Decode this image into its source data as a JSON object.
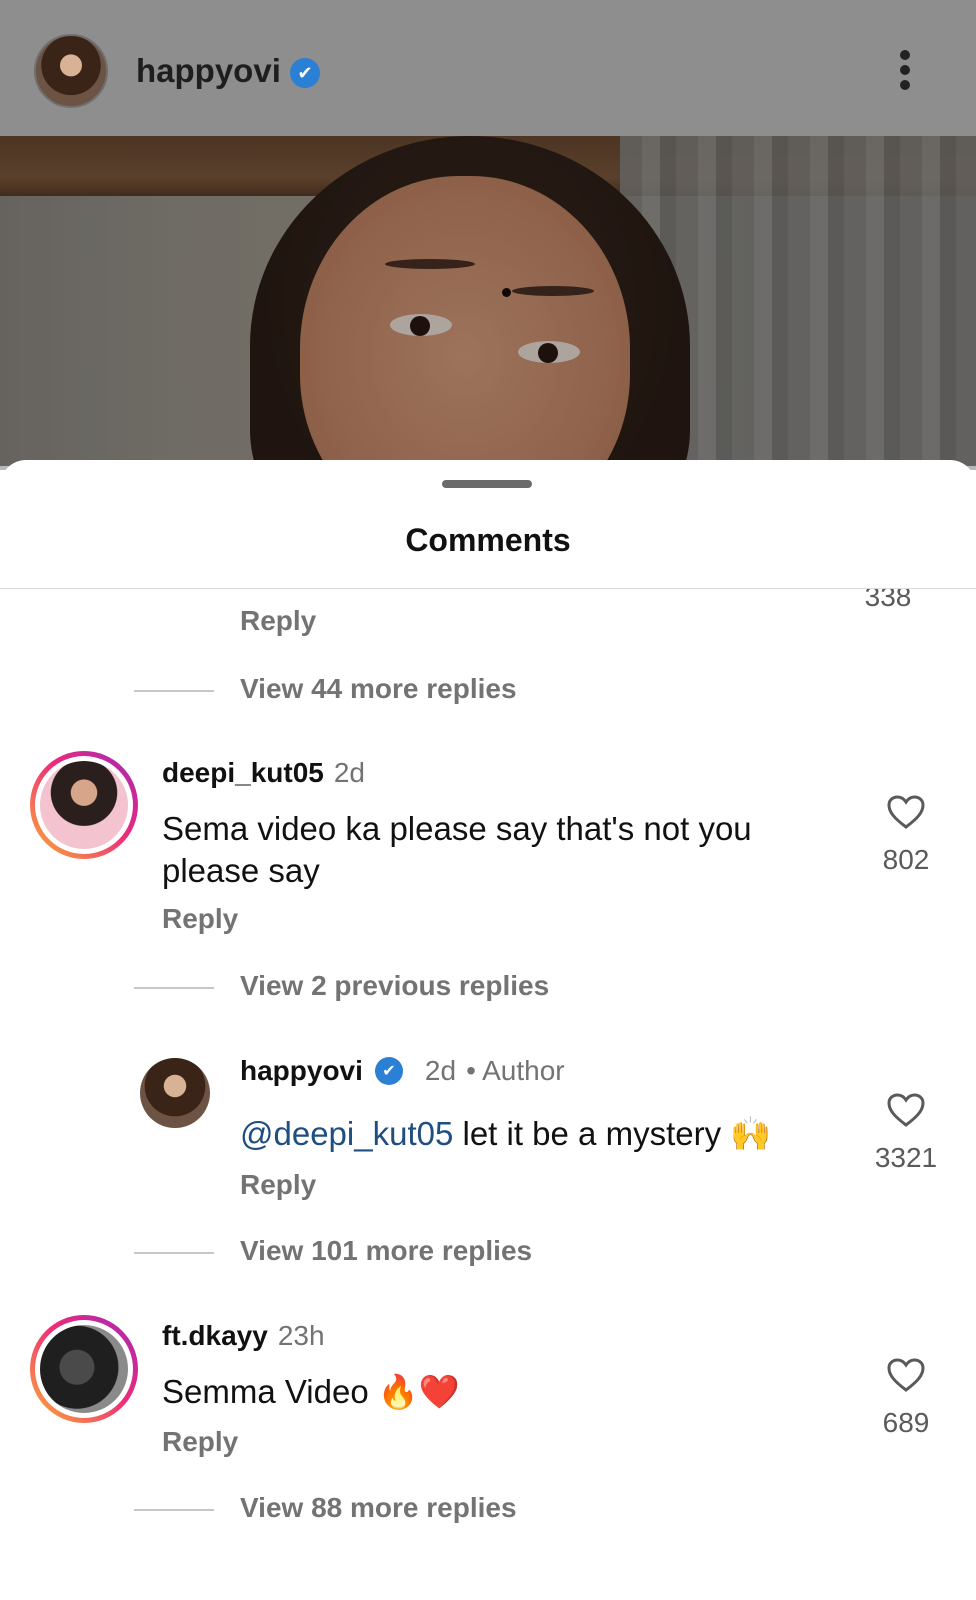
{
  "post": {
    "username": "happyovi",
    "verified_mark": "✔",
    "more_icon": "more-vertical-icon"
  },
  "sheet": {
    "title": "Comments"
  },
  "comments": {
    "top_partial": {
      "likes": "338",
      "reply_label": "Reply",
      "view_replies": "View 44 more replies"
    },
    "c1": {
      "username": "deepi_kut05",
      "time": "2d",
      "text": "Sema video ka please say that's not you please say",
      "reply_label": "Reply",
      "likes": "802",
      "view_previous": "View 2 previous replies",
      "reply": {
        "username": "happyovi",
        "verified_mark": "✔",
        "time": "2d",
        "author_tag": "• Author",
        "mention": "@deepi_kut05",
        "text": " let it be a mystery 🙌",
        "reply_label": "Reply",
        "likes": "3321"
      },
      "view_more": "View 101 more replies"
    },
    "c2": {
      "username": "ft.dkayy",
      "time": "23h",
      "text": "Semma Video 🔥❤️",
      "reply_label": "Reply",
      "likes": "689",
      "view_more": "View 88 more replies"
    }
  },
  "colors": {
    "verified": "#2b7fd4",
    "mention": "#1f4e80",
    "secondary_text": "#737373"
  }
}
